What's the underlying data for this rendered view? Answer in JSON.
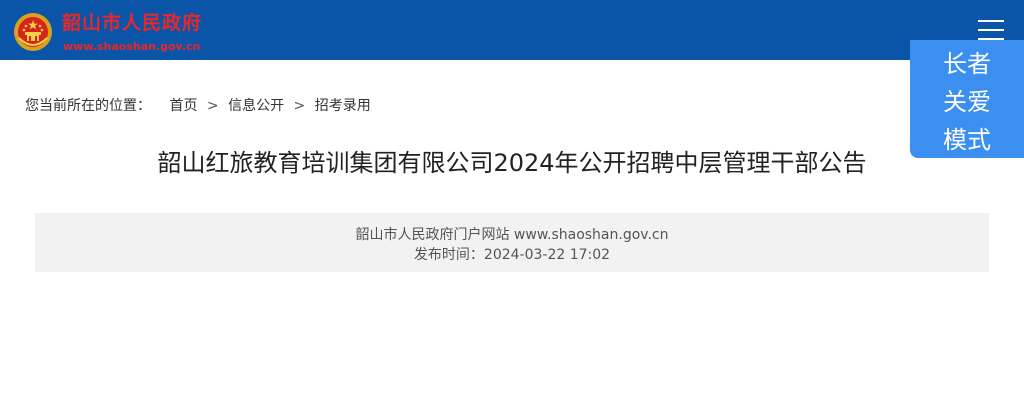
{
  "header": {
    "site_name": "韶山市人民政府",
    "site_url": "www.shaoshan.gov.cn",
    "background": "#0b55a8",
    "brand_text_color": "#e8272b"
  },
  "care_mode": {
    "lines": [
      "长者",
      "关爱",
      "模式"
    ],
    "background": "#3a8ff0"
  },
  "breadcrumb": {
    "prefix": "您当前所在的位置：",
    "items": [
      "首页",
      "信息公开",
      "招考录用"
    ],
    "separator": ">"
  },
  "article": {
    "title": "韶山红旅教育培训集团有限公司2024年公开招聘中层管理干部公告",
    "source": "韶山市人民政府门户网站 www.shaoshan.gov.cn",
    "publish_time": "发布时间：2024-03-22 17:02"
  },
  "icons": {
    "emblem": "national-emblem-icon",
    "menu": "hamburger-menu-icon"
  }
}
